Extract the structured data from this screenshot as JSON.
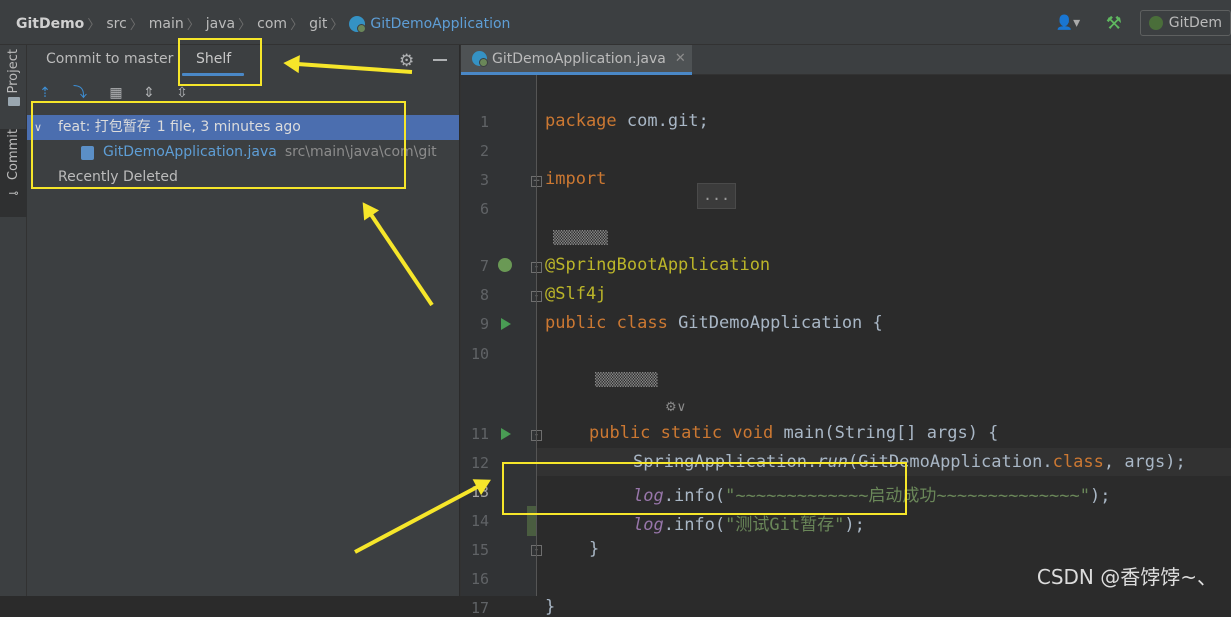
{
  "breadcrumb": {
    "project": "GitDemo",
    "parts": [
      "src",
      "main",
      "java",
      "com",
      "git"
    ],
    "file": "GitDemoApplication",
    "run_config": "GitDem"
  },
  "left_strip": {
    "project_label": "Project",
    "commit_label": "Commit"
  },
  "toolwindow": {
    "tabs": [
      "Commit to master",
      "Shelf"
    ],
    "active_tab": "Shelf",
    "shelf": {
      "changelist_name": "feat: 打包暂存",
      "changelist_meta": "1 file, 3 minutes ago",
      "file_name": "GitDemoApplication.java",
      "file_path": "src\\main\\java\\com\\git",
      "recently_deleted": "Recently Deleted"
    }
  },
  "editor": {
    "tab_name": "GitDemoApplication.java",
    "line_numbers": [
      "1",
      "2",
      "3",
      "6",
      "7",
      "8",
      "9",
      "10",
      "11",
      "12",
      "13",
      "14",
      "15",
      "16",
      "17"
    ],
    "code": {
      "l1_kw": "package",
      "l1_rest": " com.git;",
      "l3_kw": "import",
      "l3_fold": "...",
      "l7": "@SpringBootApplication",
      "l8": "@Slf4j",
      "l9_kw": "public class",
      "l9_rest": " GitDemoApplication {",
      "l11_kw": "public static void",
      "l11_rest": " main(String[] args) {",
      "l12_a": "SpringApplication.",
      "l12_b": "run",
      "l12_c": "(GitDemoApplication.",
      "l12_d": "class",
      "l12_e": ", args);",
      "l13_a": "log",
      "l13_b": ".info(",
      "l13_str": "\"~~~~~~~~~~~~~启动成功~~~~~~~~~~~~~~\"",
      "l13_c": ");",
      "l14_a": "log",
      "l14_b": ".info(",
      "l14_str": "\"测试Git暂存\"",
      "l14_c": ");",
      "l15": "}",
      "l17": "}"
    }
  },
  "watermark": "CSDN @香饽饽~、"
}
